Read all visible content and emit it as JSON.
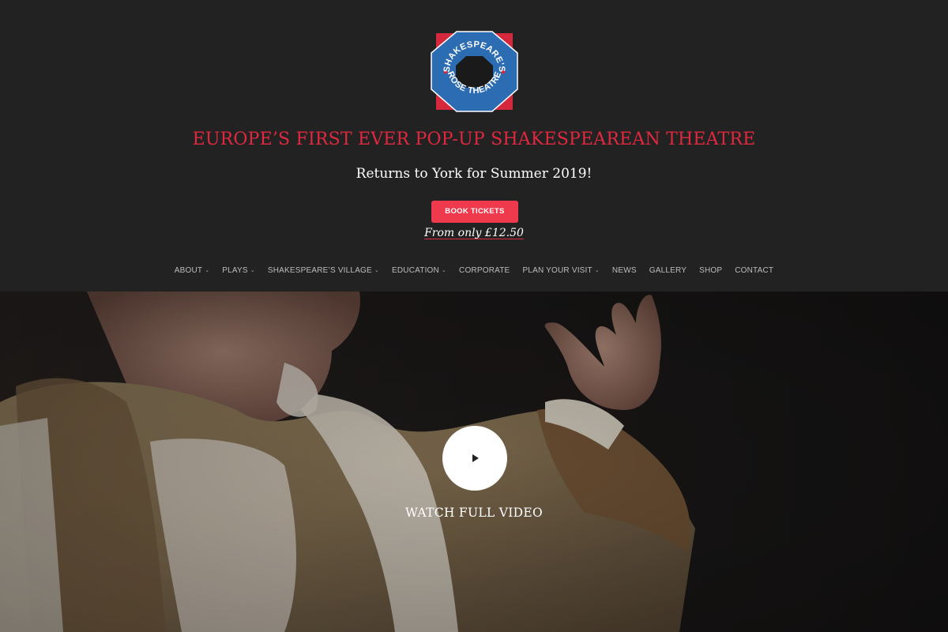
{
  "logo": {
    "top_text": "SHAKESPEARE'S",
    "bottom_text": "ROSE THEATRE",
    "colors": {
      "blue": "#2b6cb3",
      "red": "#d6283d",
      "center": "#1a1a1a"
    }
  },
  "header": {
    "headline": "EUROPE’S FIRST EVER POP-UP SHAKESPEAREAN THEATRE",
    "subheadline": "Returns to York for Summer 2019!",
    "cta_label": "BOOK TICKETS",
    "price_text": "From only £12.50"
  },
  "nav": {
    "items": [
      {
        "label": "ABOUT",
        "dropdown": true
      },
      {
        "label": "PLAYS",
        "dropdown": true
      },
      {
        "label": "SHAKESPEARE’S VILLAGE",
        "dropdown": true
      },
      {
        "label": "EDUCATION",
        "dropdown": true
      },
      {
        "label": "CORPORATE",
        "dropdown": false
      },
      {
        "label": "PLAN YOUR VISIT",
        "dropdown": true
      },
      {
        "label": "NEWS",
        "dropdown": false
      },
      {
        "label": "GALLERY",
        "dropdown": false
      },
      {
        "label": "SHOP",
        "dropdown": false
      },
      {
        "label": "CONTACT",
        "dropdown": false
      }
    ],
    "caret_glyph": "⌄"
  },
  "hero": {
    "watch_label": "WATCH FULL VIDEO",
    "play_icon": "play-icon"
  },
  "colors": {
    "accent": "#ef3a4e",
    "headline_red": "#e0283f",
    "header_bg": "#232223"
  }
}
